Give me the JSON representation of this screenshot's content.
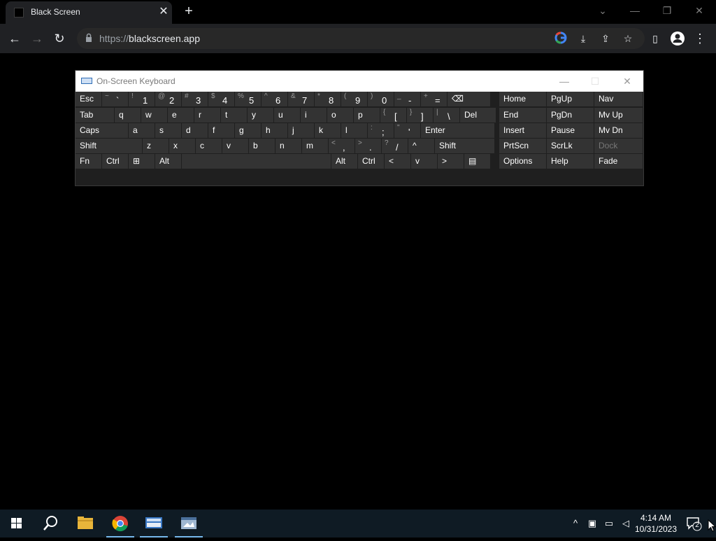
{
  "browser": {
    "tab_title": "Black Screen",
    "tab_close": "✕",
    "new_tab": "+",
    "url_scheme": "https://",
    "url_host": "blackscreen.app"
  },
  "osk": {
    "title": "On-Screen Keyboard",
    "rows": [
      [
        {
          "label": "Esc"
        },
        {
          "shift": "~",
          "main": "`"
        },
        {
          "shift": "!",
          "main": "1"
        },
        {
          "shift": "@",
          "main": "2"
        },
        {
          "shift": "#",
          "main": "3"
        },
        {
          "shift": "$",
          "main": "4"
        },
        {
          "shift": "%",
          "main": "5"
        },
        {
          "shift": "^",
          "main": "6"
        },
        {
          "shift": "&",
          "main": "7"
        },
        {
          "shift": "*",
          "main": "8"
        },
        {
          "shift": "(",
          "main": "9"
        },
        {
          "shift": ")",
          "main": "0"
        },
        {
          "shift": "_",
          "main": "-"
        },
        {
          "shift": "+",
          "main": "="
        },
        {
          "label": "⌫"
        }
      ],
      [
        {
          "label": "Tab"
        },
        {
          "label": "q"
        },
        {
          "label": "w"
        },
        {
          "label": "e"
        },
        {
          "label": "r"
        },
        {
          "label": "t"
        },
        {
          "label": "y"
        },
        {
          "label": "u"
        },
        {
          "label": "i"
        },
        {
          "label": "o"
        },
        {
          "label": "p"
        },
        {
          "shift": "{",
          "main": "["
        },
        {
          "shift": "}",
          "main": "]"
        },
        {
          "shift": "|",
          "main": "\\"
        },
        {
          "label": "Del"
        }
      ],
      [
        {
          "label": "Caps"
        },
        {
          "label": "a"
        },
        {
          "label": "s"
        },
        {
          "label": "d"
        },
        {
          "label": "f"
        },
        {
          "label": "g"
        },
        {
          "label": "h"
        },
        {
          "label": "j"
        },
        {
          "label": "k"
        },
        {
          "label": "l"
        },
        {
          "shift": ":",
          "main": ";"
        },
        {
          "shift": "\"",
          "main": "'"
        },
        {
          "label": "Enter"
        }
      ],
      [
        {
          "label": "Shift"
        },
        {
          "label": "z"
        },
        {
          "label": "x"
        },
        {
          "label": "c"
        },
        {
          "label": "v"
        },
        {
          "label": "b"
        },
        {
          "label": "n"
        },
        {
          "label": "m"
        },
        {
          "shift": "<",
          "main": ","
        },
        {
          "shift": ">",
          "main": "."
        },
        {
          "shift": "?",
          "main": "/"
        },
        {
          "label": "^"
        },
        {
          "label": "Shift"
        }
      ],
      [
        {
          "label": "Fn"
        },
        {
          "label": "Ctrl"
        },
        {
          "label": "⊞"
        },
        {
          "label": "Alt"
        },
        {
          "label": ""
        },
        {
          "label": "Alt"
        },
        {
          "label": "Ctrl"
        },
        {
          "label": "<"
        },
        {
          "label": "v"
        },
        {
          "label": ">"
        },
        {
          "label": "▤"
        }
      ]
    ],
    "nav_rows": [
      [
        {
          "label": "Home"
        },
        {
          "label": "PgUp"
        },
        {
          "label": "Nav"
        }
      ],
      [
        {
          "label": "End"
        },
        {
          "label": "PgDn"
        },
        {
          "label": "Mv Up"
        }
      ],
      [
        {
          "label": "Insert"
        },
        {
          "label": "Pause"
        },
        {
          "label": "Mv Dn"
        }
      ],
      [
        {
          "label": "PrtScn"
        },
        {
          "label": "ScrLk"
        },
        {
          "label": "Dock",
          "dim": true
        }
      ],
      [
        {
          "label": "Options"
        },
        {
          "label": "Help"
        },
        {
          "label": "Fade"
        }
      ]
    ]
  },
  "taskbar": {
    "time": "4:14 AM",
    "date": "10/31/2023",
    "notification_count": "2"
  }
}
